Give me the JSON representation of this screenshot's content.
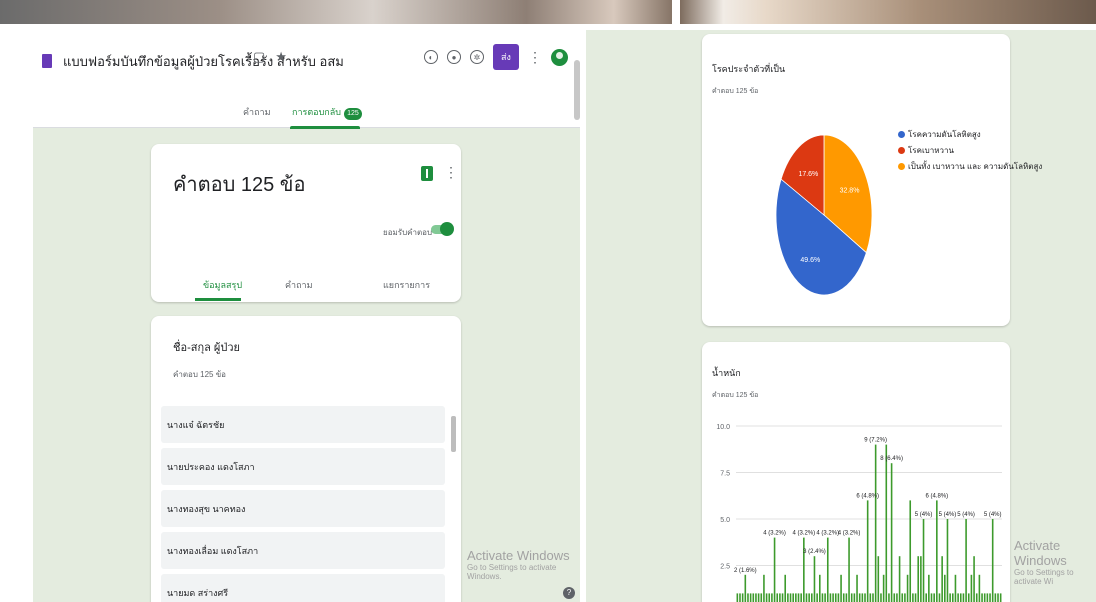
{
  "form": {
    "title": "แบบฟอร์มบันทึกข้อมูลผู้ป่วยโรคเรื้อรัง สำหรับ อสม",
    "tabs": {
      "questions": "คำถาม",
      "responses": "การตอบกลับ",
      "responses_badge": "125"
    },
    "send_label": "ส่ง",
    "colors": {
      "accent": "#1e8e3e",
      "form_purple": "#673ab7",
      "background": "#e4ecdf"
    }
  },
  "summary": {
    "response_count": "คำตอบ 125 ข้อ",
    "accepting_label": "ยอมรับคำตอบ",
    "sub_tabs": [
      "ข้อมูลสรุป",
      "คำถาม",
      "แยกรายการ"
    ]
  },
  "names_question": {
    "title": "ชื่อ-สกุล ผู้ป่วย",
    "count": "คำตอบ 125 ข้อ",
    "answers": [
      "นางแจ๋ ฉัตรชัย",
      "นายประคอง แดงโสภา",
      "นางทองสุข นาคทอง",
      "นางทองเลื่อม แดงโสภา",
      "นายมด สร่างศรี"
    ]
  },
  "watermark": {
    "title": "Activate Windows",
    "subtitle_left": "Go to Settings to activate Windows.",
    "subtitle_right": "Go to Settings to activate Wi"
  },
  "pie_question": {
    "title": "โรคประจำตัวที่เป็น",
    "count": "คำตอบ 125 ข้อ",
    "chart_data": {
      "type": "pie",
      "slices": [
        {
          "label": "โรคความดันโลหิตสูง",
          "value": 49.6,
          "display": "49.6%",
          "color": "#3366cc"
        },
        {
          "label": "โรคเบาหวาน",
          "value": 17.6,
          "display": "17.6%",
          "color": "#dc3912"
        },
        {
          "label": "เป็นทั้ง เบาหวาน และ ความดันโลหิตสูง",
          "value": 32.8,
          "display": "32.8%",
          "color": "#ff9900"
        }
      ],
      "legend": "right"
    }
  },
  "bar_question": {
    "title": "น้ำหนัก",
    "count": "คำตอบ 125 ข้อ",
    "chart_data": {
      "type": "bar",
      "color": "#3d9a2c",
      "yticks": [
        "10.0",
        "7.5",
        "5.0",
        "2.5"
      ],
      "ylim": [
        0,
        10
      ],
      "values": [
        1,
        1,
        1,
        2,
        1,
        1,
        1,
        1,
        1,
        1,
        2,
        1,
        1,
        1,
        4,
        1,
        1,
        1,
        2,
        1,
        1,
        1,
        1,
        1,
        1,
        4,
        1,
        1,
        1,
        3,
        1,
        2,
        1,
        1,
        4,
        1,
        1,
        1,
        1,
        2,
        1,
        1,
        4,
        1,
        1,
        2,
        1,
        1,
        1,
        6,
        1,
        1,
        9,
        3,
        1,
        2,
        9,
        1,
        8,
        1,
        1,
        3,
        1,
        1,
        2,
        6,
        1,
        1,
        3,
        3,
        5,
        1,
        2,
        1,
        1,
        6,
        1,
        3,
        2,
        5,
        1,
        1,
        2,
        1,
        1,
        1,
        5,
        1,
        2,
        3,
        1,
        2,
        1,
        1,
        1,
        1,
        5,
        1,
        1,
        1
      ],
      "data_labels": [
        {
          "i": 3,
          "text": "2 (1.6%)"
        },
        {
          "i": 14,
          "text": "4 (3.2%)"
        },
        {
          "i": 25,
          "text": "4 (3.2%)"
        },
        {
          "i": 29,
          "text": "3 (2.4%)"
        },
        {
          "i": 34,
          "text": "4 (3.2%)"
        },
        {
          "i": 42,
          "text": "4 (3.2%)"
        },
        {
          "i": 49,
          "text": "6 (4.8%)"
        },
        {
          "i": 52,
          "text": "9 (7.2%)"
        },
        {
          "i": 58,
          "text": "8 (6.4%)"
        },
        {
          "i": 75,
          "text": "6 (4.8%)"
        },
        {
          "i": 70,
          "text": "5 (4%)"
        },
        {
          "i": 79,
          "text": "5 (4%)"
        },
        {
          "i": 86,
          "text": "5 (4%)"
        },
        {
          "i": 96,
          "text": "5 (4%)"
        }
      ]
    }
  }
}
